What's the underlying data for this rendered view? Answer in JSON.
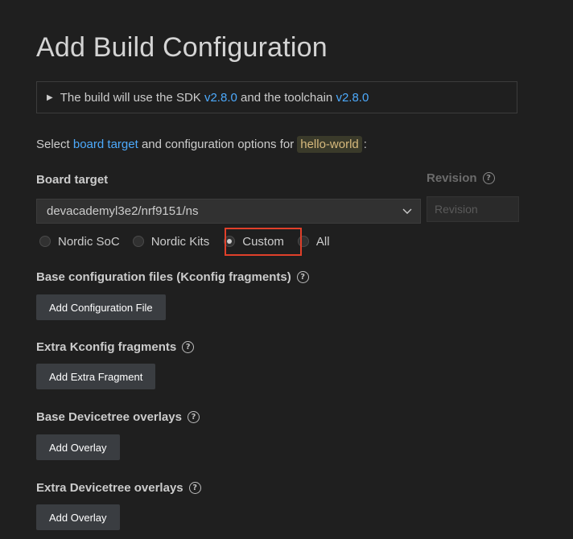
{
  "page": {
    "title": "Add Build Configuration"
  },
  "sdk_info": {
    "prefix": "The build will use the SDK",
    "sdk_version": "v2.8.0",
    "middle": "and the toolchain",
    "toolchain_version": "v2.8.0"
  },
  "select_line": {
    "prefix": "Select",
    "link": "board target",
    "middle": "and configuration options for",
    "app": "hello-world",
    "suffix": ":"
  },
  "board_target": {
    "label": "Board target",
    "value": "devacademyl3e2/nrf9151/ns"
  },
  "revision": {
    "label": "Revision",
    "placeholder": "Revision"
  },
  "board_filter": {
    "options": [
      "Nordic SoC",
      "Nordic Kits",
      "Custom",
      "All"
    ],
    "selected": "Custom"
  },
  "sections": {
    "base_config": {
      "label": "Base configuration files (Kconfig fragments)",
      "button": "Add Configuration File"
    },
    "extra_kconfig": {
      "label": "Extra Kconfig fragments",
      "button": "Add Extra Fragment"
    },
    "base_overlays": {
      "label": "Base Devicetree overlays",
      "button": "Add Overlay"
    },
    "extra_overlays": {
      "label": "Extra Devicetree overlays",
      "button": "Add Overlay"
    }
  },
  "colors": {
    "background": "#1f1f1f",
    "link": "#4daafc",
    "highlight": "#e0402a",
    "button_bg": "#3a3d41"
  }
}
